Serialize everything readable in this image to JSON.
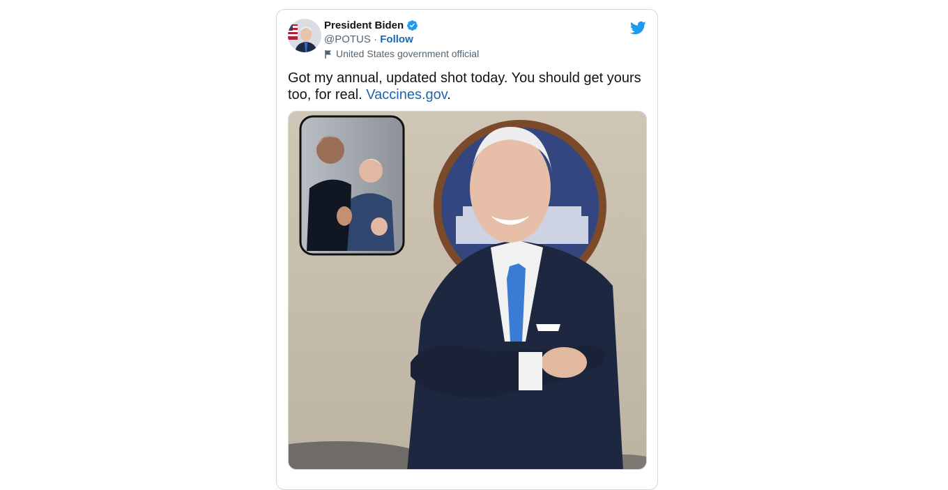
{
  "tweet": {
    "author_name": "President Biden",
    "handle": "@POTUS",
    "separator": " · ",
    "follow_label": "Follow",
    "account_label": "United States government official",
    "text_main": "Got my annual, updated shot today. You should get yours too, for real. ",
    "text_link": "Vaccines.gov",
    "text_tail": ".",
    "media": {
      "description_icon": "photo"
    }
  },
  "colors": {
    "link": "#1d65b0",
    "twitter_blue": "#1d9bf0",
    "verified": "#1d9bf0",
    "text": "#0f1419",
    "muted": "#536471"
  },
  "icons": {
    "verified": "verified-badge-icon",
    "label": "flag-icon",
    "brand": "twitter-bird-icon"
  }
}
